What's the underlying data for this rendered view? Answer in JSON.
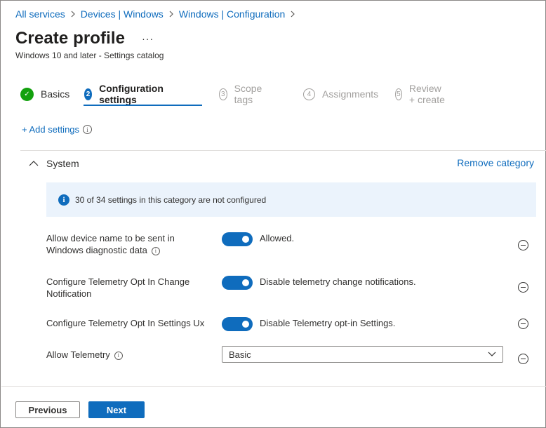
{
  "breadcrumb": [
    {
      "label": "All services"
    },
    {
      "label": "Devices | Windows"
    },
    {
      "label": "Windows | Configuration"
    }
  ],
  "header": {
    "title": "Create profile",
    "more": "···",
    "subtitle": "Windows 10 and later - Settings catalog"
  },
  "steps": [
    {
      "number": "✓",
      "label": "Basics",
      "state": "done"
    },
    {
      "number": "2",
      "label": "Configuration settings",
      "state": "active"
    },
    {
      "number": "3",
      "label": "Scope tags",
      "state": "pending"
    },
    {
      "number": "4",
      "label": "Assignments",
      "state": "pending"
    },
    {
      "number": "5",
      "label": "Review + create",
      "state": "pending"
    }
  ],
  "add_settings": {
    "label": "+ Add settings",
    "info": "i"
  },
  "category": {
    "name": "System",
    "remove_label": "Remove category",
    "info_banner": "30 of 34 settings in this category are not configured",
    "info_icon": "i"
  },
  "settings": [
    {
      "label": "Allow device name to be sent in Windows diagnostic data",
      "has_info": true,
      "info": "i",
      "type": "toggle",
      "enabled": true,
      "value": "Allowed."
    },
    {
      "label": "Configure Telemetry Opt In Change Notification",
      "has_info": false,
      "type": "toggle",
      "enabled": true,
      "value": "Disable telemetry change notifications."
    },
    {
      "label": "Configure Telemetry Opt In Settings Ux",
      "has_info": false,
      "type": "toggle",
      "enabled": true,
      "value": "Disable Telemetry opt-in Settings."
    },
    {
      "label": "Allow Telemetry",
      "has_info": true,
      "info": "i",
      "type": "dropdown",
      "value": "Basic"
    }
  ],
  "footer": {
    "previous_label": "Previous",
    "next_label": "Next"
  },
  "colors": {
    "accent": "#0f6cbd",
    "success": "#13a10e",
    "banner": "#ebf3fc"
  },
  "icons": {
    "chevron": "chevron-right-icon",
    "collapse": "chevron-up-icon",
    "info": "info-icon",
    "remove": "remove-circle-icon",
    "dropdown": "chevron-down-icon"
  }
}
